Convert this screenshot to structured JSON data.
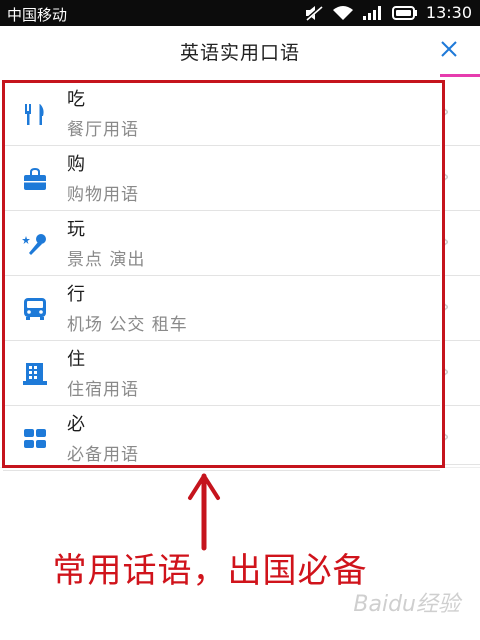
{
  "status_bar": {
    "carrier": "中国移动",
    "time": "13:30"
  },
  "header": {
    "title": "英语实用口语"
  },
  "categories": [
    {
      "name": "吃",
      "sub": "餐厅用语",
      "icon": "fork-knife-icon"
    },
    {
      "name": "购",
      "sub": "购物用语",
      "icon": "shopping-bag-icon"
    },
    {
      "name": "玩",
      "sub": "景点 演出",
      "icon": "microphone-star-icon"
    },
    {
      "name": "行",
      "sub": "机场 公交 租车",
      "icon": "bus-icon"
    },
    {
      "name": "住",
      "sub": "住宿用语",
      "icon": "hotel-icon"
    },
    {
      "name": "必",
      "sub": "必备用语",
      "icon": "grid-icon"
    }
  ],
  "annotation": {
    "caption": "常用话语，出国必备",
    "highlight_color": "#c5141d"
  },
  "watermark": "Baidu经验",
  "colors": {
    "icon_blue": "#1e7ad8",
    "accent_pink": "#e63cae",
    "caption_red": "#d0131b"
  }
}
